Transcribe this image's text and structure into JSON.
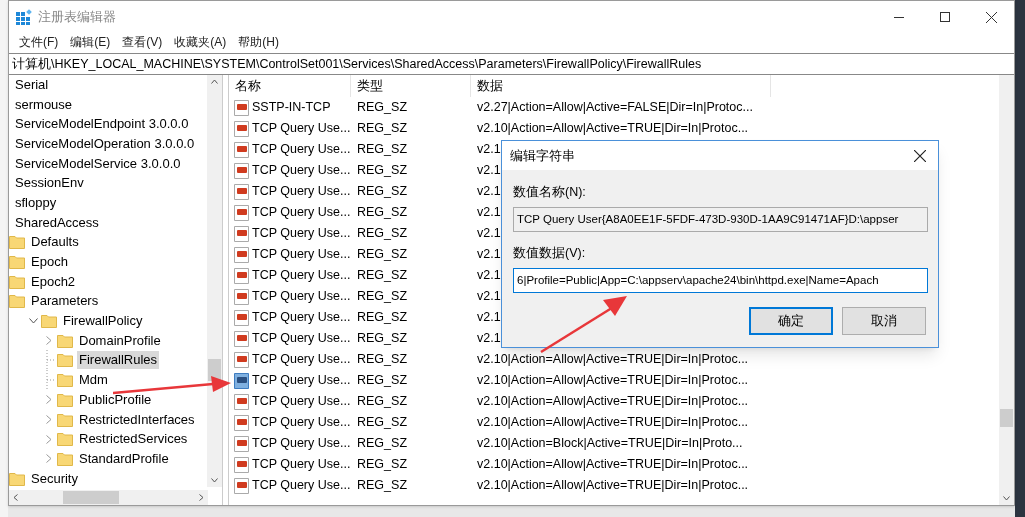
{
  "window": {
    "title": "注册表编辑器"
  },
  "menu": [
    "文件(F)",
    "编辑(E)",
    "查看(V)",
    "收藏夹(A)",
    "帮助(H)"
  ],
  "address": "计算机\\HKEY_LOCAL_MACHINE\\SYSTEM\\ControlSet001\\Services\\SharedAccess\\Parameters\\FirewallPolicy\\FirewallRules",
  "tree": [
    {
      "label": "Serial",
      "selected": false
    },
    {
      "label": "sermouse",
      "selected": false
    },
    {
      "label": "ServiceModelEndpoint 3.0.0.0",
      "selected": false
    },
    {
      "label": "ServiceModelOperation 3.0.0.0",
      "selected": false
    },
    {
      "label": "ServiceModelService 3.0.0.0",
      "selected": false
    },
    {
      "label": "SessionEnv",
      "selected": false
    },
    {
      "label": "sfloppy",
      "selected": false
    },
    {
      "label": "SharedAccess",
      "selected": false,
      "children": [
        {
          "label": "Defaults",
          "selected": false
        },
        {
          "label": "Epoch",
          "selected": false
        },
        {
          "label": "Epoch2",
          "selected": false
        },
        {
          "label": "Parameters",
          "selected": false,
          "children": [
            {
              "label": "FirewallPolicy",
              "selected": false,
              "expanded": true,
              "children": [
                {
                  "label": "DomainProfile",
                  "selected": false,
                  "expanded": false
                },
                {
                  "label": "FirewallRules",
                  "selected": true
                },
                {
                  "label": "Mdm",
                  "selected": false
                },
                {
                  "label": "PublicProfile",
                  "selected": false,
                  "expanded": false
                },
                {
                  "label": "RestrictedInterfaces",
                  "selected": false,
                  "expanded": false
                },
                {
                  "label": "RestrictedServices",
                  "selected": false,
                  "expanded": false
                },
                {
                  "label": "StandardProfile",
                  "selected": false,
                  "expanded": false
                }
              ]
            }
          ]
        },
        {
          "label": "Security",
          "selected": false
        }
      ]
    }
  ],
  "table": {
    "columns": [
      "名称",
      "类型",
      "数据"
    ],
    "rows": [
      {
        "name": "SSTP-IN-TCP",
        "type": "REG_SZ",
        "data": "v2.27|Action=Allow|Active=FALSE|Dir=In|Protoc...",
        "selected": false
      },
      {
        "name": "TCP Query Use...",
        "type": "REG_SZ",
        "data": "v2.10|Action=Allow|Active=TRUE|Dir=In|Protoc...",
        "selected": false
      },
      {
        "name": "TCP Query Use...",
        "type": "REG_SZ",
        "data": "v2.1",
        "selected": false
      },
      {
        "name": "TCP Query Use...",
        "type": "REG_SZ",
        "data": "v2.1",
        "selected": false
      },
      {
        "name": "TCP Query Use...",
        "type": "REG_SZ",
        "data": "v2.1",
        "selected": false
      },
      {
        "name": "TCP Query Use...",
        "type": "REG_SZ",
        "data": "v2.1",
        "selected": false
      },
      {
        "name": "TCP Query Use...",
        "type": "REG_SZ",
        "data": "v2.1",
        "selected": false
      },
      {
        "name": "TCP Query Use...",
        "type": "REG_SZ",
        "data": "v2.1",
        "selected": false
      },
      {
        "name": "TCP Query Use...",
        "type": "REG_SZ",
        "data": "v2.1",
        "selected": false
      },
      {
        "name": "TCP Query Use...",
        "type": "REG_SZ",
        "data": "v2.1",
        "selected": false
      },
      {
        "name": "TCP Query Use...",
        "type": "REG_SZ",
        "data": "v2.1",
        "selected": false
      },
      {
        "name": "TCP Query Use...",
        "type": "REG_SZ",
        "data": "v2.1",
        "selected": false
      },
      {
        "name": "TCP Query Use...",
        "type": "REG_SZ",
        "data": "v2.10|Action=Allow|Active=TRUE|Dir=In|Protoc...",
        "selected": false
      },
      {
        "name": "TCP Query Use...",
        "type": "REG_SZ",
        "data": "v2.10|Action=Allow|Active=TRUE|Dir=In|Protoc...",
        "selected": true
      },
      {
        "name": "TCP Query Use...",
        "type": "REG_SZ",
        "data": "v2.10|Action=Allow|Active=TRUE|Dir=In|Protoc...",
        "selected": false
      },
      {
        "name": "TCP Query Use...",
        "type": "REG_SZ",
        "data": "v2.10|Action=Allow|Active=TRUE|Dir=In|Protoc...",
        "selected": false
      },
      {
        "name": "TCP Query Use...",
        "type": "REG_SZ",
        "data": "v2.10|Action=Block|Active=TRUE|Dir=In|Proto...",
        "selected": false
      },
      {
        "name": "TCP Query Use...",
        "type": "REG_SZ",
        "data": "v2.10|Action=Allow|Active=TRUE|Dir=In|Protoc...",
        "selected": false
      },
      {
        "name": "TCP Query Use...",
        "type": "REG_SZ",
        "data": "v2.10|Action=Allow|Active=TRUE|Dir=In|Protoc...",
        "selected": false
      }
    ]
  },
  "dialog": {
    "title": "编辑字符串",
    "name_label": "数值名称(N):",
    "name_value": "TCP Query User{A8A0EE1F-5FDF-473D-930D-1AA9C91471AF}D:\\appser",
    "data_label": "数值数据(V):",
    "data_value": "6|Profile=Public|App=C:\\appserv\\apache24\\bin\\httpd.exe|Name=Apach",
    "buttons": [
      {
        "label": "确定",
        "default": true
      },
      {
        "label": "取消",
        "default": false
      }
    ]
  }
}
